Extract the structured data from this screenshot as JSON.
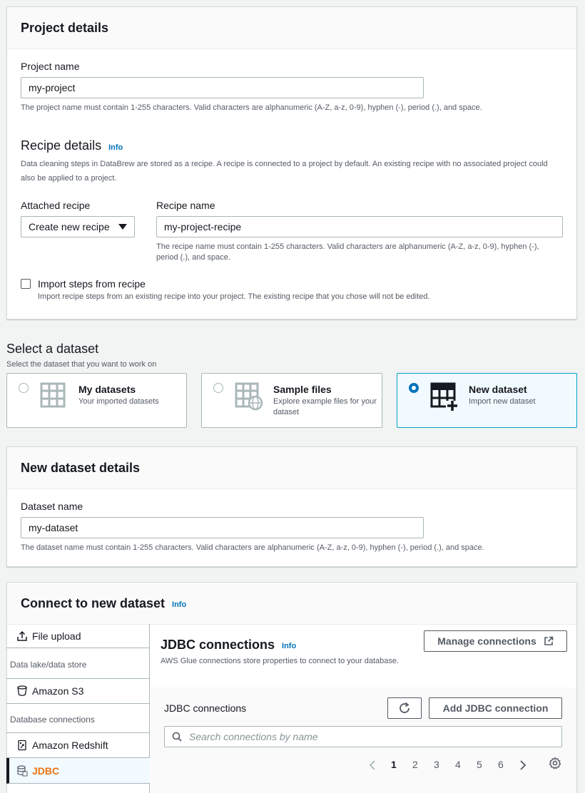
{
  "project": {
    "title": "Project details",
    "name_label": "Project name",
    "name_value": "my-project",
    "name_hint": "The project name must contain 1-255 characters. Valid characters are alphanumeric (A-Z, a-z, 0-9), hyphen (-), period (.), and space."
  },
  "recipe": {
    "title": "Recipe details",
    "info": "Info",
    "desc": "Data cleaning steps in DataBrew are stored as a recipe. A recipe is connected to a project by default. An existing recipe with no associated project could also be applied to a project.",
    "attached_label": "Attached recipe",
    "attached_value": "Create new recipe",
    "name_label": "Recipe name",
    "name_value": "my-project-recipe",
    "name_hint": "The recipe name must contain 1-255 characters. Valid characters are alphanumeric (A-Z, a-z, 0-9), hyphen (-), period (.), and space.",
    "import_label": "Import steps from recipe",
    "import_hint": "Import recipe steps from an existing recipe into your project. The existing recipe that you chose will not be edited."
  },
  "select_dataset": {
    "title": "Select a dataset",
    "subtitle": "Select the dataset that you want to work on",
    "options": [
      {
        "title": "My datasets",
        "desc": "Your imported datasets",
        "icon": "table-icon"
      },
      {
        "title": "Sample files",
        "desc": "Explore example files for your dataset",
        "icon": "table-globe-icon"
      },
      {
        "title": "New dataset",
        "desc": "Import new dataset",
        "icon": "table-plus-icon"
      }
    ]
  },
  "new_dataset": {
    "title": "New dataset details",
    "name_label": "Dataset name",
    "name_value": "my-dataset",
    "name_hint": "The dataset name must contain 1-255 characters. Valid characters are alphanumeric (A-Z, a-z, 0-9), hyphen (-), period (.), and space."
  },
  "connect": {
    "title": "Connect to new dataset",
    "info": "Info",
    "sidebar": {
      "file_upload": "File upload",
      "group_lake": "Data lake/data store",
      "s3": "Amazon S3",
      "group_db": "Database connections",
      "redshift": "Amazon Redshift",
      "jdbc": "JDBC"
    },
    "jdbc": {
      "title": "JDBC connections",
      "info": "Info",
      "desc": "AWS Glue connections store properties to connect to your database.",
      "manage_button": "Manage connections",
      "table_label": "JDBC connections",
      "add_button": "Add JDBC connection",
      "search_placeholder": "Search connections by name",
      "pages": [
        "1",
        "2",
        "3",
        "4",
        "5",
        "6"
      ]
    }
  },
  "colors": {
    "accent": "#0073bb",
    "selected_border": "#00a1c9",
    "active_orange": "#ec7211"
  }
}
